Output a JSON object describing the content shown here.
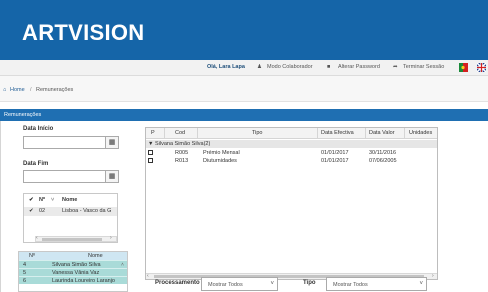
{
  "brand": {
    "logo": "ARTVISION",
    "header_color": "#1565a8"
  },
  "userbar": {
    "user_name": "Olá, Lara Lapa",
    "mode": "Modo Colaborador",
    "change_password": "Alterar Password",
    "logout": "Terminar Sessão"
  },
  "breadcrumb": {
    "home": "Home",
    "separator": "/",
    "current": "Remunerações"
  },
  "panel": {
    "title": "Remunerações"
  },
  "filters": {
    "date_start_label": "Data Início",
    "date_start_value": "",
    "date_end_label": "Data Fim",
    "date_end_value": ""
  },
  "location_list": {
    "headers": {
      "check": "✔",
      "num": "Nº",
      "name": "Nome"
    },
    "rows": [
      {
        "check": "✔",
        "num": "02",
        "name": "Lisboa - Vasco da G"
      }
    ]
  },
  "employees": {
    "headers": {
      "num": "Nº",
      "name": "Nome"
    },
    "rows": [
      {
        "num": "4",
        "name": "Silvana Simão Silva"
      },
      {
        "num": "5",
        "name": "Vanessa Vânia Vaz"
      },
      {
        "num": "6",
        "name": "Laurinda Loureiro Laranjo"
      }
    ]
  },
  "grid": {
    "columns": [
      "P",
      "Cod",
      "Tipo",
      "Data Efectiva",
      "Data Valor",
      "Unidades"
    ],
    "group_label": "▼ Silvana Simão Silva(2)",
    "rows": [
      {
        "cod": "R005",
        "tipo": "Prémio Mensal",
        "data_efectiva": "01/01/2017",
        "data_valor": "30/11/2016",
        "unidades": ""
      },
      {
        "cod": "R013",
        "tipo": "Diuturnidades",
        "data_efectiva": "01/01/2017",
        "data_valor": "07/06/2005",
        "unidades": ""
      }
    ]
  },
  "footer_filters": {
    "processamento_label": "Processamento",
    "processamento_value": "Mostrar Todos",
    "tipo_label": "Tipo",
    "tipo_value": "Mostrar Todos"
  }
}
